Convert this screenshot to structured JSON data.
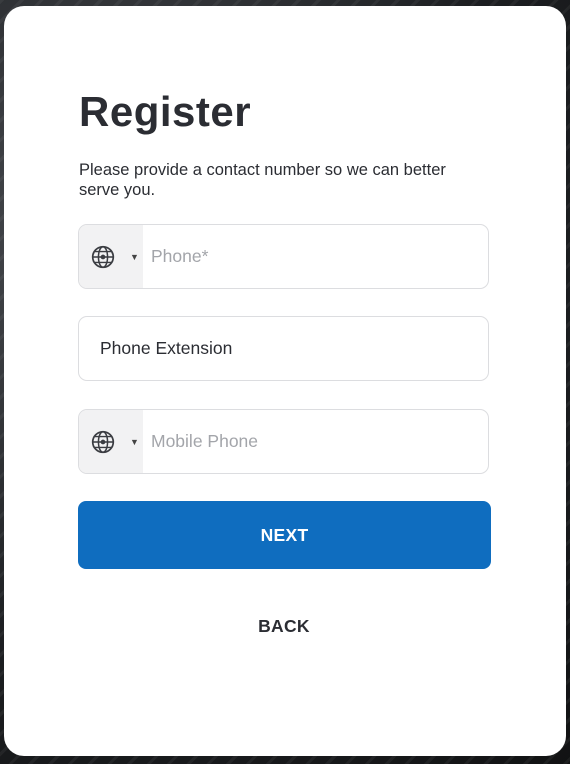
{
  "form": {
    "title": "Register",
    "subtitle": "Please provide a contact number so we can better serve you.",
    "phone": {
      "placeholder": "Phone*",
      "value": "",
      "country_icon": "globe-icon",
      "dropdown_icon": "caret-down-icon"
    },
    "extension": {
      "placeholder": "Phone Extension",
      "value": ""
    },
    "mobile": {
      "placeholder": "Mobile Phone",
      "value": "",
      "country_icon": "globe-icon",
      "dropdown_icon": "caret-down-icon"
    },
    "next_label": "NEXT",
    "back_label": "BACK"
  },
  "colors": {
    "primary": "#0f6dbf",
    "text": "#2b2d33",
    "placeholder": "#a3a5aa",
    "border": "#dcdde0",
    "country_bg": "#f2f2f3"
  }
}
